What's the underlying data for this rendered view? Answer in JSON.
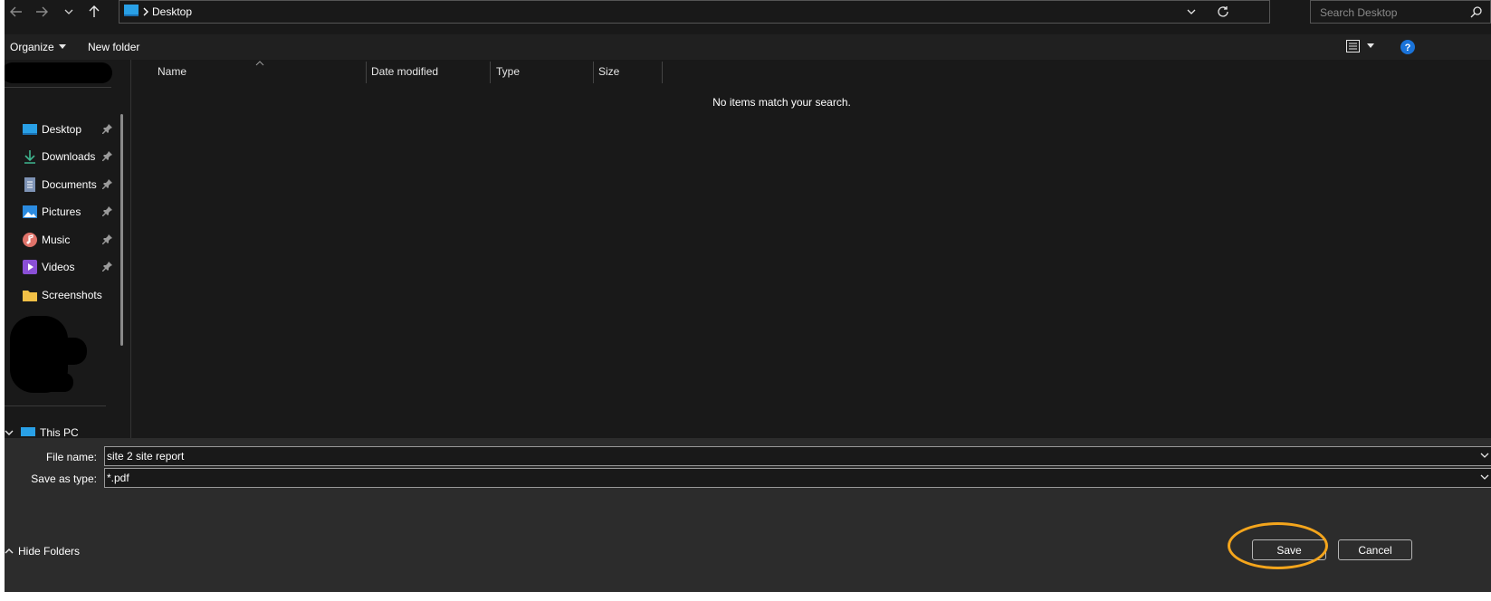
{
  "address": {
    "location": "Desktop"
  },
  "search": {
    "placeholder": "Search Desktop"
  },
  "toolbar": {
    "organize": "Organize",
    "new_folder": "New folder"
  },
  "sidebar": {
    "items": [
      {
        "label": "Desktop",
        "icon": "desktop-icon",
        "pinned": true
      },
      {
        "label": "Downloads",
        "icon": "download-icon",
        "pinned": true
      },
      {
        "label": "Documents",
        "icon": "document-icon",
        "pinned": true
      },
      {
        "label": "Pictures",
        "icon": "pictures-icon",
        "pinned": true
      },
      {
        "label": "Music",
        "icon": "music-icon",
        "pinned": true
      },
      {
        "label": "Videos",
        "icon": "videos-icon",
        "pinned": true
      },
      {
        "label": "Screenshots",
        "icon": "folder-icon",
        "pinned": false
      }
    ],
    "this_pc": "This PC"
  },
  "columns": [
    "Name",
    "Date modified",
    "Type",
    "Size"
  ],
  "empty_message": "No items match your search.",
  "form": {
    "file_name_label": "File name:",
    "file_name_value": "site 2 site report",
    "save_type_label": "Save as type:",
    "save_type_value": "*.pdf"
  },
  "buttons": {
    "save": "Save",
    "cancel": "Cancel",
    "hide_folders": "Hide Folders"
  },
  "colors": {
    "background": "#191919",
    "toolbar": "#202020",
    "footer": "#2c2c2c",
    "highlight": "#f4a51c",
    "help": "#1a73d9"
  }
}
